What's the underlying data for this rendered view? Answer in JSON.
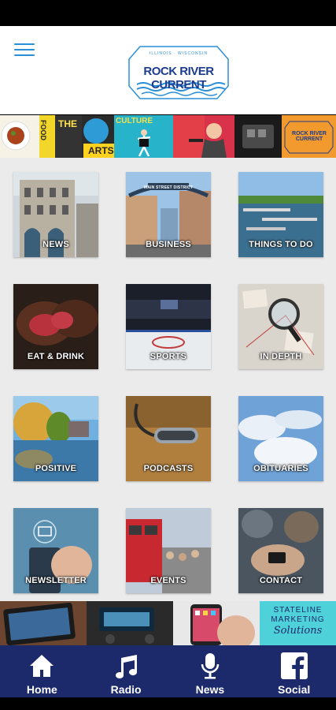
{
  "header": {
    "logo_top": "ILLINOIS · WISCONSIN",
    "logo_title": "ROCK RIVER CURRENT"
  },
  "banner": {
    "labels": [
      "FOOD",
      "THE",
      "ARTS",
      "CULTURE",
      "ROCK RIVER CURRENT"
    ]
  },
  "tiles": [
    {
      "label": "NEWS"
    },
    {
      "label": "BUSINESS"
    },
    {
      "label": "THINGS TO DO"
    },
    {
      "label": "EAT & DRINK"
    },
    {
      "label": "SPORTS"
    },
    {
      "label": "IN DEPTH"
    },
    {
      "label": "POSITIVE"
    },
    {
      "label": "PODCASTS"
    },
    {
      "label": "OBITUARIES"
    },
    {
      "label": "NEWSLETTER"
    },
    {
      "label": "EVENTS"
    },
    {
      "label": "CONTACT"
    }
  ],
  "tile_sign": "MAIN STREET DISTRICT",
  "ad": {
    "line1": "STATELINE",
    "line2": "MARKETING",
    "script": "Solutions"
  },
  "tabs": [
    {
      "label": "Home",
      "icon": "home-icon"
    },
    {
      "label": "Radio",
      "icon": "music-note-icon"
    },
    {
      "label": "News",
      "icon": "microphone-icon"
    },
    {
      "label": "Social",
      "icon": "facebook-icon"
    }
  ],
  "colors": {
    "tabbar": "#1c2a6b",
    "accent": "#2a8fd6",
    "logo": "#1b3c8f"
  }
}
